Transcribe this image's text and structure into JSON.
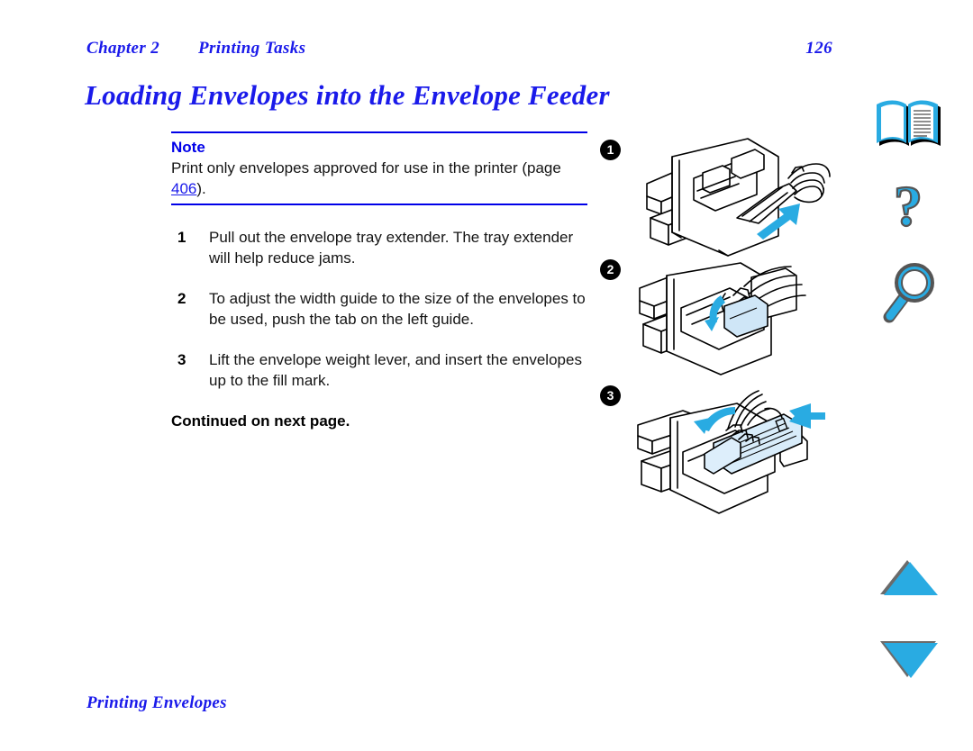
{
  "header": {
    "chapter": "Chapter 2",
    "section": "Printing Tasks",
    "page_number": "126"
  },
  "title": "Loading Envelopes into the Envelope Feeder",
  "note": {
    "label": "Note",
    "text_before": "Print only envelopes approved for use in the printer (page ",
    "link": "406",
    "text_after": ")."
  },
  "steps": [
    {
      "num": "1",
      "text": "Pull out the envelope tray extender. The tray extender will help reduce jams."
    },
    {
      "num": "2",
      "text": "To adjust the width guide to the size of the envelopes to be used, push the tab on the left guide."
    },
    {
      "num": "3",
      "text": "Lift the envelope weight lever, and insert the envelopes up to the fill mark."
    }
  ],
  "continued": "Continued on next page.",
  "footer": "Printing Envelopes",
  "illustrations": [
    {
      "callout": "1",
      "caption": "envelope-feeder-tray-extender-pull-out"
    },
    {
      "callout": "2",
      "caption": "envelope-feeder-width-guide-adjust"
    },
    {
      "callout": "3",
      "caption": "envelope-feeder-weight-lever-lift"
    }
  ],
  "nav_icons": [
    {
      "name": "open-book-icon",
      "label": "Contents"
    },
    {
      "name": "question-mark-icon",
      "label": "Help"
    },
    {
      "name": "magnifier-icon",
      "label": "Search"
    },
    {
      "name": "triangle-up-icon",
      "label": "Previous page"
    },
    {
      "name": "triangle-down-icon",
      "label": "Next page"
    }
  ],
  "colors": {
    "heading_blue": "#1a1aea",
    "rule_blue": "#0000e8",
    "icon_cyan": "#29ABE2",
    "icon_shadow": "#6b6b6b",
    "arrow_cyan": "#29ABE2",
    "text_black": "#141414"
  }
}
